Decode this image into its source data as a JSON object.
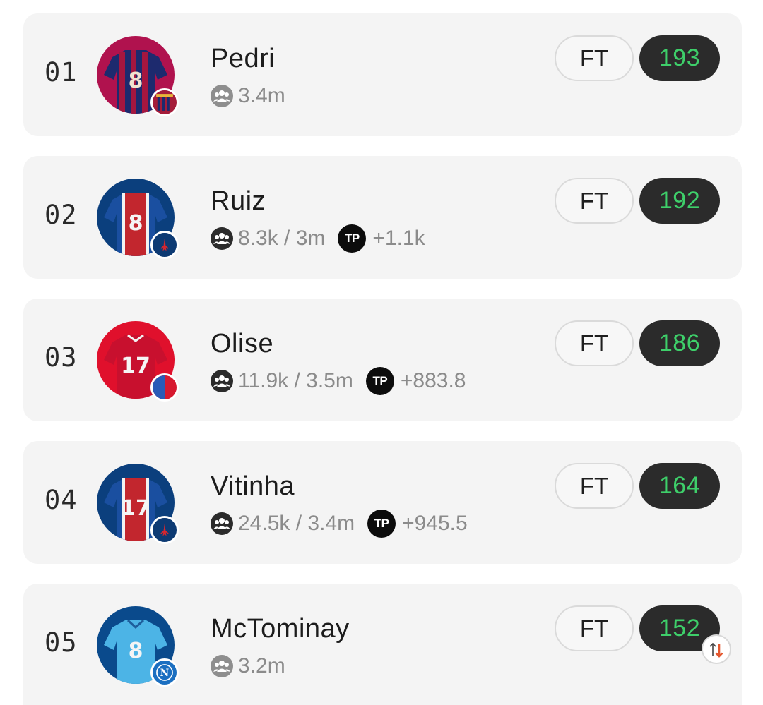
{
  "players": [
    {
      "rank": "01",
      "name": "Pedri",
      "followers": "3.4m",
      "tp": null,
      "status": "FT",
      "score": "193",
      "kit": "barca",
      "kit_number": "8",
      "users_icon": "users-icon",
      "crest": "barcelona-crest"
    },
    {
      "rank": "02",
      "name": "Ruiz",
      "followers": "8.3k / 3m",
      "tp": "+1.1k",
      "status": "FT",
      "score": "192",
      "kit": "psg",
      "kit_number": "8",
      "users_icon": "users-icon",
      "crest": "psg-crest"
    },
    {
      "rank": "03",
      "name": "Olise",
      "followers": "11.9k / 3.5m",
      "tp": "+883.8",
      "status": "FT",
      "score": "186",
      "kit": "bayern",
      "kit_number": "17",
      "users_icon": "users-icon",
      "crest": "bayern-crest"
    },
    {
      "rank": "04",
      "name": "Vitinha",
      "followers": "24.5k / 3.4m",
      "tp": "+945.5",
      "status": "FT",
      "score": "164",
      "kit": "psg",
      "kit_number": "17",
      "users_icon": "users-icon",
      "crest": "psg-crest"
    },
    {
      "rank": "05",
      "name": "McTominay",
      "followers": "3.2m",
      "tp": null,
      "status": "FT",
      "score": "152",
      "kit": "napoli",
      "kit_number": "8",
      "users_icon": "users-icon",
      "crest": "napoli-crest",
      "trend": "transfer-down-icon"
    }
  ],
  "tp_label": "TP",
  "crest_letter_napoli": "N",
  "colors": {
    "card_bg": "#f4f4f4",
    "score_bg": "#2b2b2b",
    "score_text": "#3ecf6a",
    "meta_text": "#8b8b8b",
    "trend_arrow": "#e4572e"
  }
}
